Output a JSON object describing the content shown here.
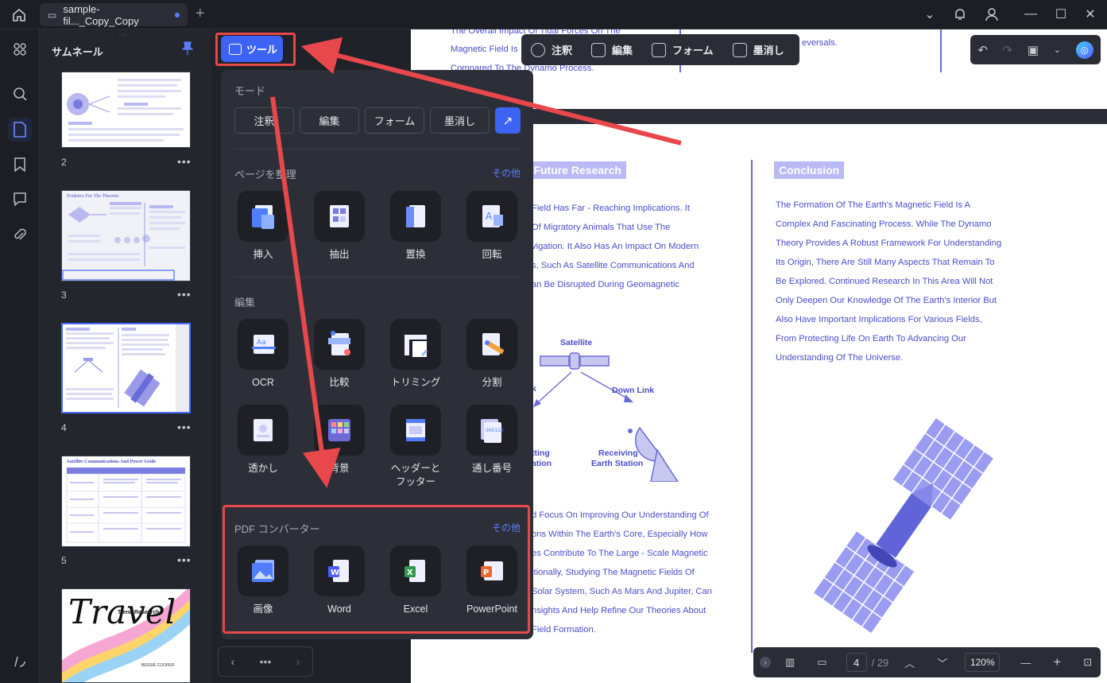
{
  "titlebar": {
    "tab_label": "sample-fil..._Copy_Copy"
  },
  "thumbnails": {
    "title": "サムネール",
    "pages": [
      {
        "num": "2",
        "more": "•••"
      },
      {
        "num": "3",
        "more": "•••"
      },
      {
        "num": "4",
        "more": "•••"
      },
      {
        "num": "5",
        "more": "•••"
      },
      {
        "num": "",
        "more": ""
      }
    ],
    "page3_heading": "Evidence For The Theories",
    "page5_heading": "Satellite Communications And Power Grids",
    "page6_title": "Travel",
    "page6_sub": "Trend Research",
    "page6_author": "BESSIE COOPER"
  },
  "tools": {
    "button_label": "ツール",
    "mode_section": "モード",
    "modes": [
      "注釈",
      "編集",
      "フォーム",
      "墨消し"
    ],
    "pages_section": "ページを整理",
    "pages_more": "その他",
    "pages_tools": [
      "挿入",
      "抽出",
      "置換",
      "回転"
    ],
    "edit_section": "編集",
    "edit_tools": [
      "OCR",
      "比較",
      "トリミング",
      "分割",
      "透かし",
      "背景",
      "ヘッダーと\nフッター",
      "通し番号"
    ],
    "convert_section": "PDF コンバーター",
    "convert_more": "その他",
    "convert_tools": [
      "画像",
      "Word",
      "Excel",
      "PowerPoint"
    ],
    "nav_more": "•••"
  },
  "modebar": {
    "items": [
      "注釈",
      "編集",
      "フォーム",
      "墨消し"
    ]
  },
  "document": {
    "top_lines": [
      "The Overall Impact Of Tidal Forces On The",
      "Magnetic Field Is",
      "Compared To The Dynamo Process."
    ],
    "top_right": "eversals.",
    "left_heading": "d Future Research",
    "left_lines": [
      "Field Has Far - Reaching Implications. It",
      "Of Migratory Animals That Use The",
      "vigation. It Also Has An Impact On Modern",
      "s, Such As Satellite Communications And",
      "an Be Disrupted During Geomagnetic"
    ],
    "diagram": {
      "satellite": "Satellite",
      "down_link": "Down Link",
      "up_link": "k",
      "receiving": "Receiving",
      "earth_station": "Earth Station",
      "tting": "tting",
      "ation": "ation"
    },
    "left_lines2": [
      "d Focus On Improving Our Understanding Of",
      "ons Within The Earth's Core, Especially How",
      "es Contribute To The Large - Scale Magnetic",
      "itionally, Studying The Magnetic Fields Of",
      "Solar System, Such As Mars And Jupiter, Can",
      "nsights And Help Refine Our Theories About",
      "Field Formation."
    ],
    "conclusion_heading": "Conclusion",
    "conclusion_lines": [
      "The Formation Of The Earth's Magnetic Field Is A",
      "Complex And Fascinating Process. While The Dynamo",
      "Theory Provides A Robust Framework For Understanding",
      "Its Origin, There Are Still Many Aspects That Remain To",
      "Be Explored. Continued Research In This Area Will Not",
      "Only Deepen Our Knowledge Of The Earth's Interior But",
      "Also Have Important Implications For Various Fields,",
      "From Protecting Life On Earth To Advancing Our",
      "Understanding Of The Universe."
    ]
  },
  "statusbar": {
    "page": "4",
    "total": "/ 29",
    "zoom": "120%"
  },
  "colors": {
    "accent": "#3d63f5",
    "highlight": "#e8474b",
    "doc_text": "#4b4dc8"
  }
}
